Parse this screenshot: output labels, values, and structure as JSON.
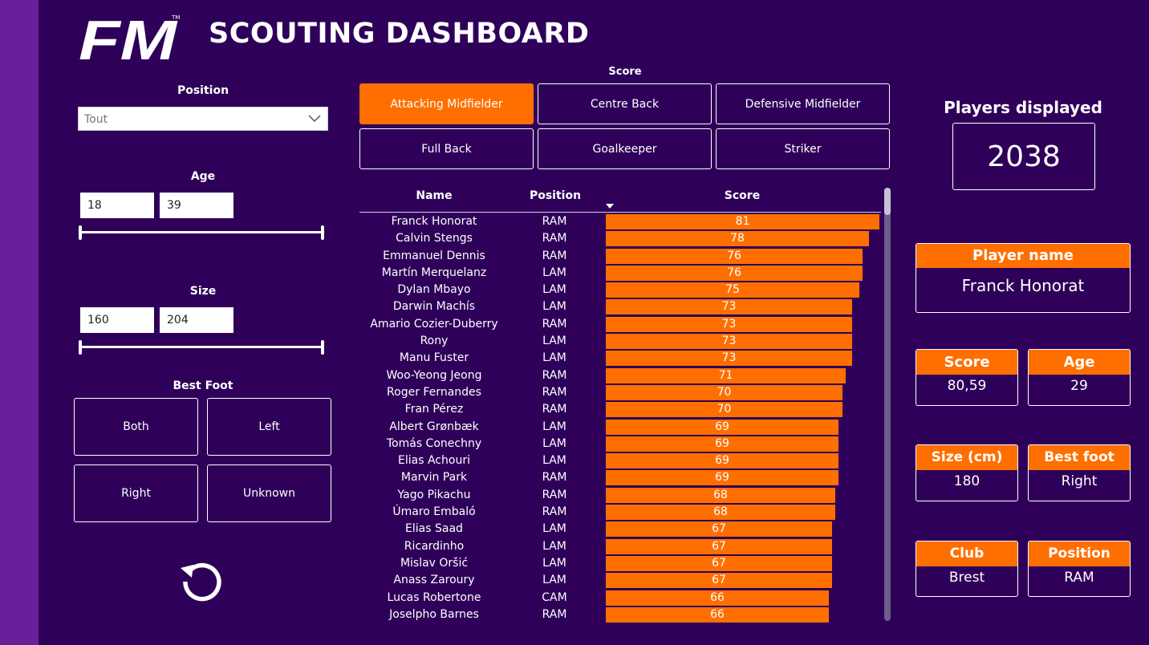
{
  "header": {
    "logo": "FM",
    "title": "SCOUTING DASHBOARD"
  },
  "filters": {
    "position": {
      "label": "Position",
      "selected": "Tout"
    },
    "age": {
      "label": "Age",
      "min": "18",
      "max": "39"
    },
    "size": {
      "label": "Size",
      "min": "160",
      "max": "204"
    },
    "best_foot": {
      "label": "Best Foot",
      "options": [
        "Both",
        "Left",
        "Right",
        "Unknown"
      ]
    }
  },
  "score_selector": {
    "label": "Score",
    "options": [
      "Attacking Midfielder",
      "Centre Back",
      "Defensive Midfielder",
      "Full Back",
      "Goalkeeper",
      "Striker"
    ],
    "active": "Attacking Midfielder"
  },
  "table": {
    "columns": [
      "Name",
      "Position",
      "Score"
    ],
    "score_max": 81,
    "rows": [
      {
        "name": "Franck Honorat",
        "position": "RAM",
        "score": 81
      },
      {
        "name": "Calvin Stengs",
        "position": "RAM",
        "score": 78
      },
      {
        "name": "Emmanuel Dennis",
        "position": "RAM",
        "score": 76
      },
      {
        "name": "Martín Merquelanz",
        "position": "LAM",
        "score": 76
      },
      {
        "name": "Dylan Mbayo",
        "position": "LAM",
        "score": 75
      },
      {
        "name": "Darwin Machís",
        "position": "LAM",
        "score": 73
      },
      {
        "name": "Amario Cozier-Duberry",
        "position": "RAM",
        "score": 73
      },
      {
        "name": "Rony",
        "position": "LAM",
        "score": 73
      },
      {
        "name": "Manu Fuster",
        "position": "LAM",
        "score": 73
      },
      {
        "name": "Woo-Yeong Jeong",
        "position": "RAM",
        "score": 71
      },
      {
        "name": "Roger Fernandes",
        "position": "RAM",
        "score": 70
      },
      {
        "name": "Fran Pérez",
        "position": "RAM",
        "score": 70
      },
      {
        "name": "Albert Grønbæk",
        "position": "LAM",
        "score": 69
      },
      {
        "name": "Tomás Conechny",
        "position": "LAM",
        "score": 69
      },
      {
        "name": "Elias Achouri",
        "position": "LAM",
        "score": 69
      },
      {
        "name": "Marvin Park",
        "position": "RAM",
        "score": 69
      },
      {
        "name": "Yago Pikachu",
        "position": "RAM",
        "score": 68
      },
      {
        "name": "Úmaro Embaló",
        "position": "RAM",
        "score": 68
      },
      {
        "name": "Elias Saad",
        "position": "LAM",
        "score": 67
      },
      {
        "name": "Ricardinho",
        "position": "LAM",
        "score": 67
      },
      {
        "name": "Mislav Oršić",
        "position": "LAM",
        "score": 67
      },
      {
        "name": "Anass Zaroury",
        "position": "LAM",
        "score": 67
      },
      {
        "name": "Lucas Robertone",
        "position": "CAM",
        "score": 66
      },
      {
        "name": "Joselpho Barnes",
        "position": "RAM",
        "score": 66
      }
    ]
  },
  "summary": {
    "players_label": "Players displayed",
    "players_count": "2038"
  },
  "player_card": {
    "name_label": "Player name",
    "name": "Franck Honorat",
    "score_label": "Score",
    "score": "80,59",
    "age_label": "Age",
    "age": "29",
    "size_label": "Size (cm)",
    "size": "180",
    "foot_label": "Best foot",
    "foot": "Right",
    "club_label": "Club",
    "club": "Brest",
    "position_label": "Position",
    "position": "RAM"
  },
  "colors": {
    "background": "#2e0059",
    "accent": "#ff6f00",
    "side_strip": "#6a1f9a"
  },
  "icons": {
    "reset": "reset-icon",
    "dropdown": "chevron-down-icon"
  }
}
